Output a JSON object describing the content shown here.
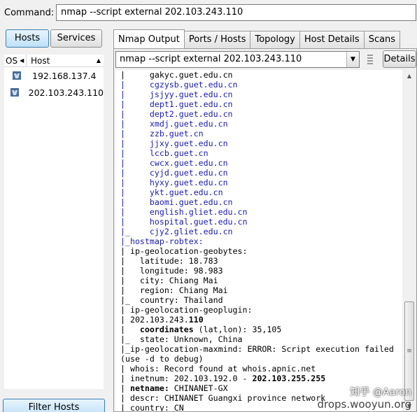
{
  "command": {
    "label": "Command:",
    "value": "nmap --script external 202.103.243.110"
  },
  "left_panel": {
    "toggle": {
      "hosts": "Hosts",
      "services": "Services",
      "selected": "Hosts"
    },
    "columns": {
      "os": "OS",
      "host": "Host"
    },
    "hosts": [
      {
        "ip": "192.168.137.4",
        "os_icon": "unknown-os-icon"
      },
      {
        "ip": "202.103.243.110",
        "os_icon": "unknown-os-icon"
      }
    ],
    "filter_button": "Filter Hosts"
  },
  "tabs": [
    "Nmap Output",
    "Ports / Hosts",
    "Topology",
    "Host Details",
    "Scans"
  ],
  "active_tab": "Nmap Output",
  "scan_select": {
    "value": "nmap --script external 202.103.243.110"
  },
  "details_button": "Details",
  "output_lines": [
    {
      "text": "|     gakyc.guet.edu.cn"
    },
    {
      "text": "|     cgzysb.guet.edu.cn",
      "color": "blue"
    },
    {
      "text": "|     jsjyy.guet.edu.cn",
      "color": "blue"
    },
    {
      "text": "|     dept1.guet.edu.cn",
      "color": "blue"
    },
    {
      "text": "|     dept2.guet.edu.cn",
      "color": "blue"
    },
    {
      "text": "|     xmdj.guet.edu.cn",
      "color": "blue"
    },
    {
      "text": "|     zzb.guet.cn",
      "color": "blue"
    },
    {
      "text": "|     jjxy.guet.edu.cn",
      "color": "blue"
    },
    {
      "text": "|     lccb.guet.cn",
      "color": "blue"
    },
    {
      "text": "|     cwcx.guet.edu.cn",
      "color": "blue"
    },
    {
      "text": "|     cyjd.guet.edu.cn",
      "color": "blue"
    },
    {
      "text": "|     hyxy.guet.edu.cn",
      "color": "blue"
    },
    {
      "text": "|     ykt.guet.edu.cn",
      "color": "blue"
    },
    {
      "text": "|     baomi.guet.edu.cn",
      "color": "blue"
    },
    {
      "text": "|     english.gliet.edu.cn",
      "color": "blue"
    },
    {
      "text": "|     hospital.guet.edu.cn",
      "color": "blue"
    },
    {
      "text": "|_    cjy2.gliet.edu.cn",
      "color": "blue"
    },
    {
      "text": "|_hostmap-robtex:",
      "color": "blue"
    },
    {
      "text": "| ip-geolocation-geobytes:"
    },
    {
      "text": "|   latitude: 18.783"
    },
    {
      "text": "|   longitude: 98.983"
    },
    {
      "text": "|   city: Chiang Mai"
    },
    {
      "text": "|   region: Chiang Mai"
    },
    {
      "text": "|_  country: Thailand"
    },
    {
      "text": "| ip-geolocation-geoplugin:"
    },
    {
      "text": "| 202.103.243.",
      "bold": "110"
    },
    {
      "text": "|   ",
      "bold": "coordinates",
      "rest": " (lat,lon): 35,105"
    },
    {
      "text": "|_  state: Unknown, China"
    },
    {
      "text": "|_ip-geolocation-maxmind: ERROR: Script execution failed"
    },
    {
      "text": "(use -d to debug)"
    },
    {
      "text": "| whois: Record found at whois.apnic.net"
    },
    {
      "text": "| inetnum: 202.103.192.0 - ",
      "bold": "202.103.255.255"
    },
    {
      "text": "| ",
      "bold": "netname:",
      "rest": " CHINANET-GX"
    },
    {
      "text": "| descr: CHINANET Guangxi province network"
    },
    {
      "text": "| country: CN"
    }
  ],
  "watermark": {
    "line1": "知乎 @Aaron",
    "line2": "drops.wooyun.org"
  }
}
